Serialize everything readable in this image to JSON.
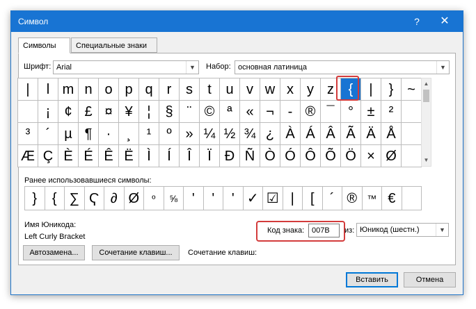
{
  "window": {
    "title": "Символ",
    "help": "?",
    "close": "✕"
  },
  "tabs": [
    {
      "label": "Символы"
    },
    {
      "label": "Специальные знаки"
    }
  ],
  "font": {
    "label": "Шрифт:",
    "value": "Arial"
  },
  "subset": {
    "label": "Набор:",
    "value": "основная латиница"
  },
  "symbols": [
    "|",
    "l",
    "m",
    "n",
    "o",
    "p",
    "q",
    "r",
    "s",
    "t",
    "u",
    "v",
    "w",
    "x",
    "y",
    "z",
    "{",
    "|",
    "}",
    "~",
    "",
    "¡",
    "¢",
    "£",
    "¤",
    "¥",
    "¦",
    "§",
    "¨",
    "©",
    "ª",
    "«",
    "¬",
    "-",
    "®",
    "¯",
    "°",
    "±",
    "²",
    "",
    "³",
    "´",
    "µ",
    "¶",
    "·",
    "¸",
    "¹",
    "º",
    "»",
    "¼",
    "½",
    "¾",
    "¿",
    "À",
    "Á",
    "Â",
    "Ã",
    "Ä",
    "Å",
    "",
    "Æ",
    "Ç",
    "È",
    "É",
    "Ê",
    "Ë",
    "Ì",
    "Í",
    "Î",
    "Ï",
    "Ð",
    "Ñ",
    "Ò",
    "Ó",
    "Ô",
    "Õ",
    "Ö",
    "×",
    "Ø",
    ""
  ],
  "selected_symbol": "{",
  "recent": {
    "label": "Ранее использовавшиеся символы:",
    "items": [
      "}",
      "{",
      "∑",
      "Ҁ",
      "∂",
      "Ø",
      "º",
      "⅝",
      "'",
      "'",
      "'",
      "✓",
      "☑",
      "|",
      "[",
      "´",
      "®",
      "™",
      "€",
      ""
    ]
  },
  "unicode_name": {
    "label": "Имя Юникода:",
    "value": "Left Curly Bracket"
  },
  "char_code": {
    "label": "Код знака:",
    "value": "007B"
  },
  "from": {
    "label": "из:",
    "value": "Юникод (шестн.)"
  },
  "buttons": {
    "autocorrect": "Автозамена...",
    "shortcut_key": "Сочетание клавиш...",
    "shortcut_label": "Сочетание клавиш:",
    "insert": "Вставить",
    "cancel": "Отмена"
  }
}
